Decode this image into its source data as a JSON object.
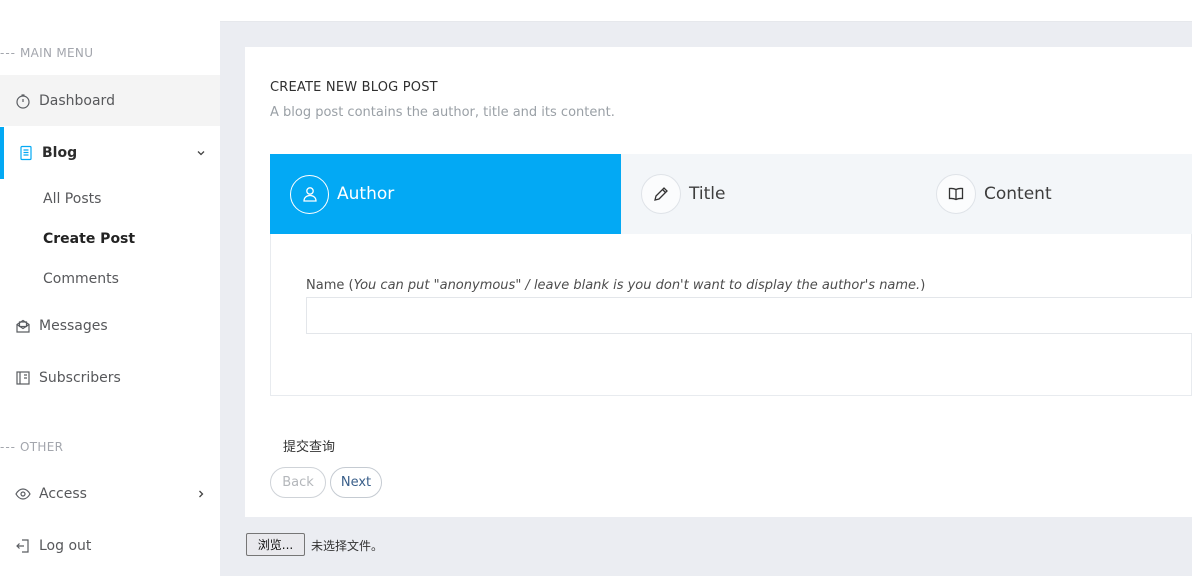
{
  "sidebar": {
    "main_menu_dash": "---",
    "main_menu_label": "MAIN MENU",
    "other_dash": "---",
    "other_label": "OTHER",
    "items": {
      "dashboard": "Dashboard",
      "blog": "Blog",
      "messages": "Messages",
      "subscribers": "Subscribers",
      "access": "Access",
      "logout": "Log out"
    },
    "blog_sub": {
      "all_posts": "All Posts",
      "create_post": "Create Post",
      "comments": "Comments"
    },
    "accent_color": "#03a9f4"
  },
  "card": {
    "title": "CREATE NEW BLOG POST",
    "subtitle": "A blog post contains the author, title and its content.",
    "steps": {
      "author": "Author",
      "title": "Title",
      "content": "Content"
    },
    "field": {
      "label": "Name",
      "hint": "You can put \"anonymous\" / leave blank is you don't want to display the author's name.",
      "value": ""
    },
    "submit_text": "提交查询",
    "back_label": "Back",
    "next_label": "Next"
  },
  "file_input": {
    "button_label": "浏览...",
    "status": "未选择文件。"
  }
}
